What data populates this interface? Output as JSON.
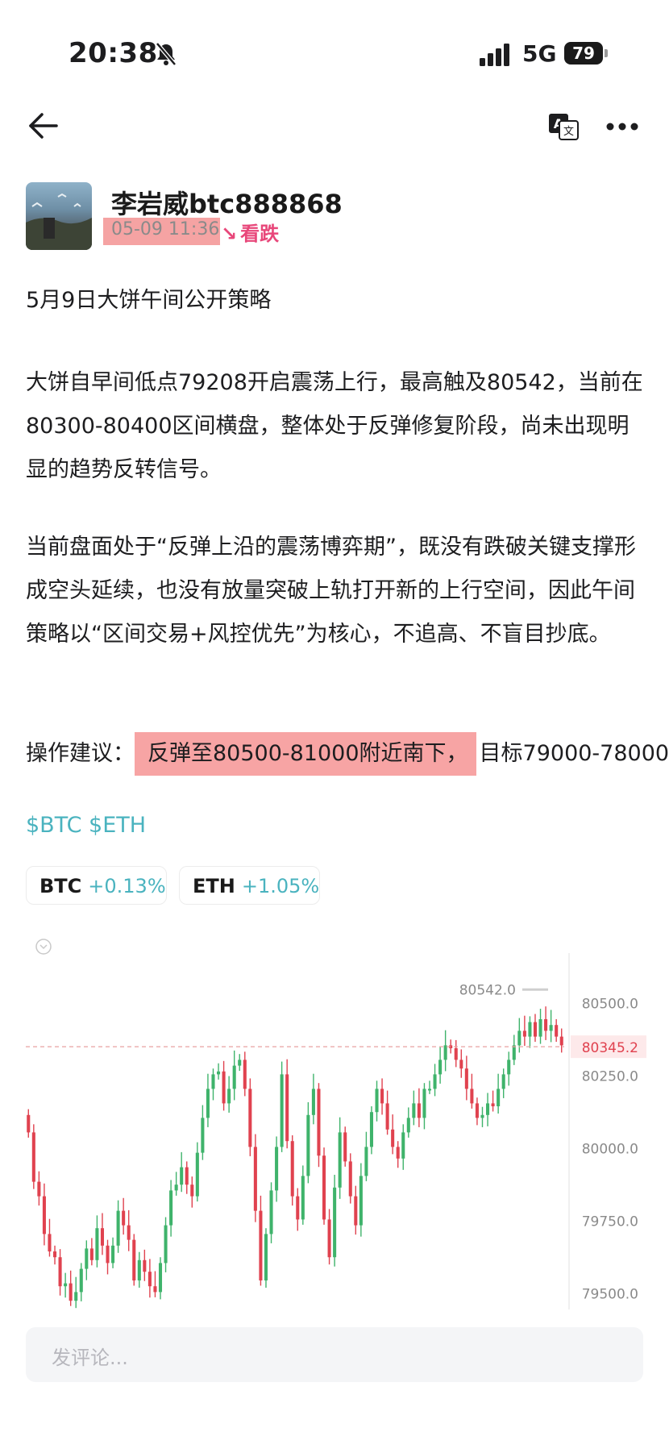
{
  "status_bar": {
    "time": "20:38",
    "network": "5G",
    "battery": "79"
  },
  "header": {
    "back": "back-icon",
    "translate": "translate-icon",
    "more": "more-icon"
  },
  "author": {
    "name": "李岩威btc888868",
    "post_time": "05-09 11:36",
    "sentiment": "看跌",
    "sentiment_color": "#e8477a"
  },
  "post": {
    "title": "5月9日大饼午间公开策略",
    "paragraph1": "大饼自早间低点79208开启震荡上行，最高触及80542，当前在80300-80400区间横盘，整体处于反弹修复阶段，尚未出现明显的趋势反转信号。",
    "paragraph2": "当前盘面处于“反弹上沿的震荡博弈期”，既没有跌破关键支撑形成空头延续，也没有放量突破上轨打开新的上行空间，因此午间策略以“区间交易+风控优先”为核心，不追高、不盲目抄底。",
    "advice_label": "操作建议：",
    "advice_highlight": "反弹至80500-81000附近南下，",
    "advice_target": "目标79000-78000",
    "tags": "$BTC $ETH"
  },
  "tickers": [
    {
      "symbol": "BTC",
      "change": "+0.13%"
    },
    {
      "symbol": "ETH",
      "change": "+1.05%"
    }
  ],
  "chart_data": {
    "type": "candlestick",
    "high_label": "80542.0",
    "current_price": "80345.2",
    "y_ticks": [
      "80500.0",
      "80250.0",
      "80000.0",
      "79750.0",
      "79500.0"
    ],
    "ylim": [
      79440,
      80640
    ],
    "colors": {
      "up": "#3fb36b",
      "down": "#e0424f",
      "current_line": "#e0424f"
    },
    "closes": [
      80050,
      79880,
      79830,
      79700,
      79640,
      79620,
      79520,
      79530,
      79470,
      79500,
      79580,
      79650,
      79610,
      79720,
      79660,
      79600,
      79660,
      79780,
      79730,
      79680,
      79540,
      79610,
      79570,
      79520,
      79500,
      79600,
      79730,
      79850,
      79870,
      79930,
      79870,
      79830,
      79980,
      80100,
      80200,
      80250,
      80260,
      80150,
      80200,
      80280,
      80300,
      80200,
      80000,
      79780,
      79540,
      79700,
      79850,
      80000,
      80250,
      80020,
      79830,
      79750,
      79900,
      80110,
      80200,
      79970,
      79750,
      79620,
      79860,
      80050,
      79950,
      79830,
      79730,
      79900,
      80000,
      80120,
      80200,
      80150,
      80060,
      80000,
      79960,
      80050,
      80100,
      80150,
      80100,
      80200,
      80200,
      80250,
      80300,
      80350,
      80340,
      80300,
      80270,
      80200,
      80150,
      80100,
      80110,
      80150,
      80140,
      80200,
      80250,
      80300,
      80350,
      80400,
      80380,
      80430,
      80380,
      80440,
      80400,
      80420,
      80380,
      80350
    ]
  },
  "comment": {
    "placeholder": "发评论..."
  }
}
